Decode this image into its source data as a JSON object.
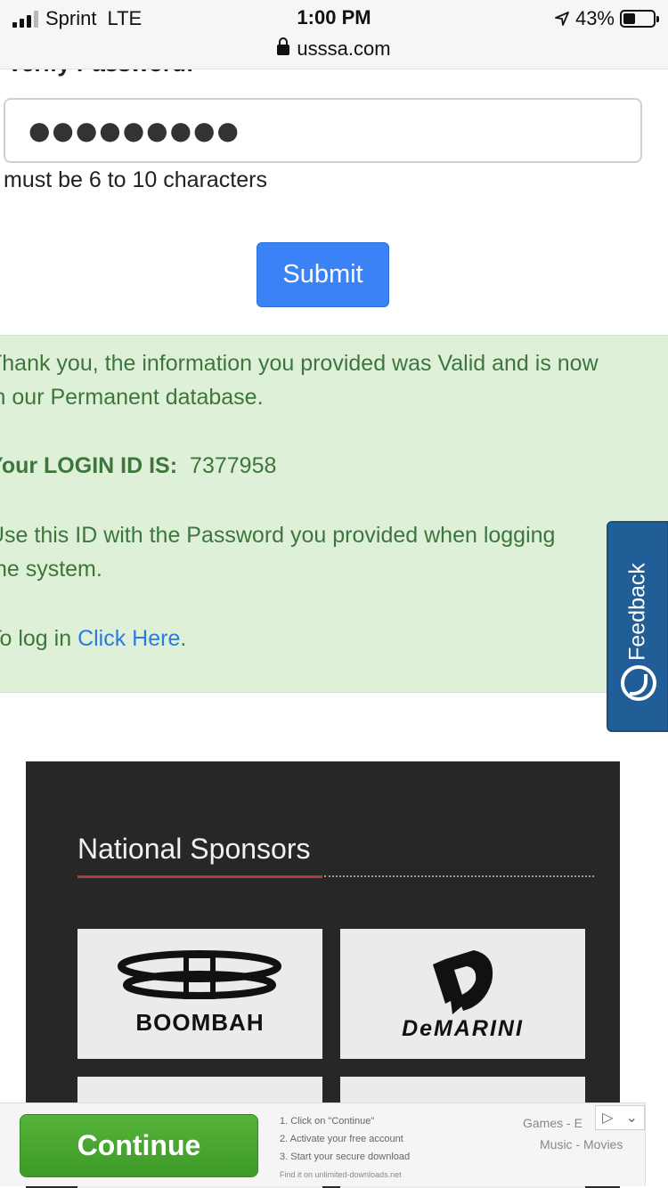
{
  "status_bar": {
    "carrier": "Sprint",
    "network": "LTE",
    "time": "1:00 PM",
    "url": "usssa.com",
    "battery": "43%"
  },
  "form": {
    "cut_label": "Verify Password:",
    "password_value": "●●●●●●●●●",
    "hint": "must be 6 to 10 characters",
    "submit_label": "Submit"
  },
  "alert": {
    "line1": "Thank you, the information you provided was Valid and is now",
    "line2": "in our Permanent database.",
    "login_label": "Your LOGIN ID IS:",
    "login_id": "7377958",
    "line4": "Use this ID with the Password you provided when logging",
    "line5": "the system.",
    "login_prefix": "To log in",
    "login_link": "Click Here",
    "login_suffix": "."
  },
  "feedback": {
    "label": "Feedback"
  },
  "sponsors": {
    "title": "National Sponsors",
    "logos": [
      {
        "name": "BOOMBAH"
      },
      {
        "name": "DeMARINI"
      }
    ]
  },
  "ad": {
    "button": "Continue",
    "step1": "1. Click on \"Continue\"",
    "step2": "2. Activate your free account",
    "step3": "3. Start your secure download",
    "footnote": "Find it on unlimited-downloads.net",
    "cat1": "Games - E",
    "cat2": "Music - Movies"
  },
  "colors": {
    "submit": "#3b82f6",
    "alert_bg": "#dff0d8",
    "alert_text": "#3c763d",
    "feedback_bg": "#215d97",
    "sponsors_bg": "#272727",
    "sponsor_accent": "#b33a3a",
    "ad_button": "#4aa831"
  }
}
